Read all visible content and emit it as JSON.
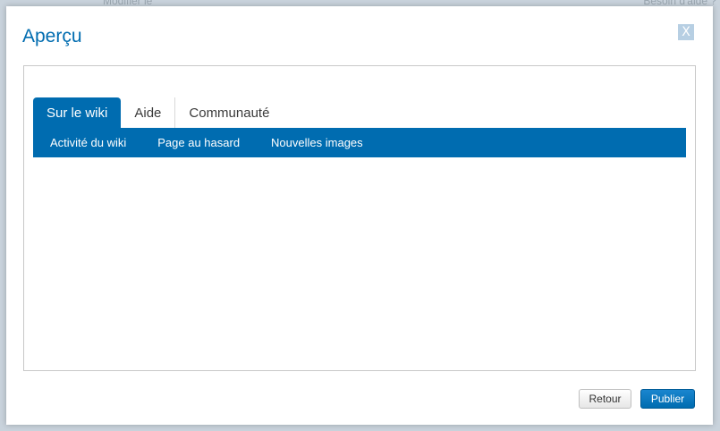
{
  "backdrop": {
    "left_text": "Modifier le",
    "right_text": "Besoin d'aide ?"
  },
  "modal": {
    "title": "Aperçu",
    "close_label": "X"
  },
  "preview": {
    "tabs": [
      {
        "label": "Sur le wiki",
        "active": true
      },
      {
        "label": "Aide",
        "active": false
      },
      {
        "label": "Communauté",
        "active": false
      }
    ],
    "subnav": [
      {
        "label": "Activité du wiki"
      },
      {
        "label": "Page au hasard"
      },
      {
        "label": "Nouvelles images"
      }
    ]
  },
  "footer": {
    "back_label": "Retour",
    "publish_label": "Publier"
  },
  "colors": {
    "accent": "#006cb0",
    "close_bg": "#b7cfe3",
    "backdrop": "#c9d3dc"
  },
  "icons": {
    "close": "close-icon"
  }
}
